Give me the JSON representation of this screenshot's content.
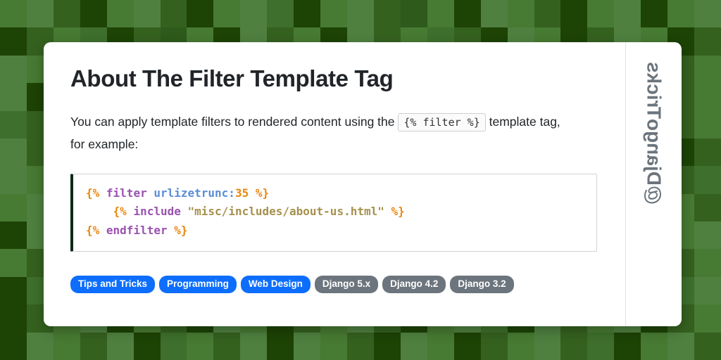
{
  "background": {
    "name": "green-pixel-mosaic",
    "palette": [
      "#477a32",
      "#4f8040",
      "#35611f",
      "#1d4305",
      "#3e6f2c",
      "#2e5a1c"
    ],
    "cols": 27,
    "rows": 13,
    "cells": [
      0,
      1,
      2,
      3,
      0,
      1,
      2,
      3,
      0,
      1,
      4,
      3,
      0,
      1,
      2,
      5,
      0,
      3,
      1,
      0,
      2,
      3,
      0,
      1,
      3,
      0,
      1,
      3,
      2,
      0,
      4,
      3,
      2,
      5,
      0,
      3,
      1,
      2,
      0,
      3,
      1,
      2,
      0,
      4,
      2,
      3,
      1,
      0,
      3,
      2,
      1,
      0,
      3,
      2,
      1,
      0,
      1,
      2,
      0,
      3,
      1,
      0,
      2,
      4,
      0,
      1,
      3,
      2,
      0,
      1,
      2,
      3,
      0,
      1,
      4,
      2,
      0,
      3,
      1,
      2,
      0,
      1,
      3,
      2,
      0,
      3,
      1,
      2,
      0,
      1,
      3,
      0,
      2,
      1,
      3,
      0,
      2,
      4,
      1,
      0,
      3,
      2,
      1,
      0,
      3,
      1,
      2,
      0,
      4,
      2,
      0,
      0,
      3,
      1,
      2,
      0,
      4,
      3,
      1,
      0,
      2,
      3,
      0,
      1,
      2,
      4,
      0,
      3,
      1,
      2,
      0,
      1,
      3,
      2,
      0,
      1,
      2,
      3,
      1,
      1,
      2,
      0,
      3,
      1,
      0,
      2,
      3,
      4,
      1,
      0,
      2,
      3,
      0,
      1,
      3,
      0,
      2,
      1,
      4,
      0,
      3,
      2,
      1,
      0,
      1,
      3,
      0,
      3,
      0,
      1,
      2,
      3,
      1,
      0,
      4,
      2,
      0,
      3,
      1,
      2,
      3,
      0,
      1,
      2,
      0,
      3,
      1,
      2,
      4,
      0,
      1,
      3,
      0,
      2,
      1,
      0,
      2,
      3,
      1,
      0,
      2,
      1,
      3,
      0,
      4,
      1,
      2,
      0,
      3,
      2,
      1,
      0,
      3,
      1,
      0,
      2,
      3,
      1,
      2,
      0,
      1,
      4,
      3,
      2,
      1,
      0,
      3,
      4,
      0,
      1,
      2,
      3,
      0,
      2,
      1,
      3,
      0,
      1,
      4,
      2,
      3,
      0,
      1,
      0,
      2,
      3,
      1,
      2,
      0,
      3,
      0,
      1,
      3,
      2,
      0,
      1,
      3,
      0,
      2,
      1,
      3,
      4,
      0,
      2,
      1,
      3,
      0,
      1,
      2,
      0,
      3,
      4,
      1,
      2,
      0,
      3,
      1,
      0,
      2,
      0,
      1,
      3,
      2,
      0,
      1,
      4,
      3,
      0,
      2,
      1,
      0,
      3,
      2,
      1,
      0,
      4,
      1,
      3,
      2,
      0,
      1,
      3,
      0,
      2,
      3,
      1,
      0,
      3,
      2,
      0,
      1,
      2,
      3,
      0,
      1,
      4,
      3,
      1,
      2,
      0,
      1,
      3,
      2,
      0,
      3,
      1,
      0,
      2,
      1,
      3,
      4,
      0,
      2,
      1,
      3,
      1,
      0,
      2,
      3,
      1,
      0,
      3,
      2,
      0,
      1,
      2,
      4,
      3,
      0,
      1,
      2,
      3,
      1,
      0,
      2,
      3,
      0,
      1,
      2,
      4,
      0,
      3,
      1
    ]
  },
  "card": {
    "title": "About The Filter Template Tag",
    "intro": {
      "before": "You can apply template filters to rendered content using the",
      "inline_code": "{% filter %}",
      "after": "template tag, for example:"
    },
    "code_block": {
      "language": "django-template",
      "lines": [
        {
          "tokens": [
            {
              "type": "tag",
              "text": "{%"
            },
            {
              "type": "plain",
              "text": " "
            },
            {
              "type": "kw",
              "text": "filter"
            },
            {
              "type": "plain",
              "text": " "
            },
            {
              "type": "name",
              "text": "urlizetrunc:"
            },
            {
              "type": "num",
              "text": "35"
            },
            {
              "type": "plain",
              "text": " "
            },
            {
              "type": "tag",
              "text": "%}"
            }
          ]
        },
        {
          "tokens": [
            {
              "type": "plain",
              "text": "    "
            },
            {
              "type": "tag",
              "text": "{%"
            },
            {
              "type": "plain",
              "text": " "
            },
            {
              "type": "kw",
              "text": "include"
            },
            {
              "type": "plain",
              "text": " "
            },
            {
              "type": "str",
              "text": "\"misc/includes/about-us.html\""
            },
            {
              "type": "plain",
              "text": " "
            },
            {
              "type": "tag",
              "text": "%}"
            }
          ]
        },
        {
          "tokens": [
            {
              "type": "tag",
              "text": "{%"
            },
            {
              "type": "plain",
              "text": " "
            },
            {
              "type": "kw",
              "text": "endfilter"
            },
            {
              "type": "plain",
              "text": " "
            },
            {
              "type": "tag",
              "text": "%}"
            }
          ]
        }
      ]
    },
    "badges": [
      {
        "label": "Tips and Tricks",
        "style": "primary",
        "color": "#0d6efd"
      },
      {
        "label": "Programming",
        "style": "primary",
        "color": "#0d6efd"
      },
      {
        "label": "Web Design",
        "style": "primary",
        "color": "#0d6efd"
      },
      {
        "label": "Django 5.x",
        "style": "secondary",
        "color": "#6c757d"
      },
      {
        "label": "Django 4.2",
        "style": "secondary",
        "color": "#6c757d"
      },
      {
        "label": "Django 3.2",
        "style": "secondary",
        "color": "#6c757d"
      }
    ],
    "side_handle": {
      "label": "@DjangoTricks",
      "color": "#6c757d"
    }
  }
}
